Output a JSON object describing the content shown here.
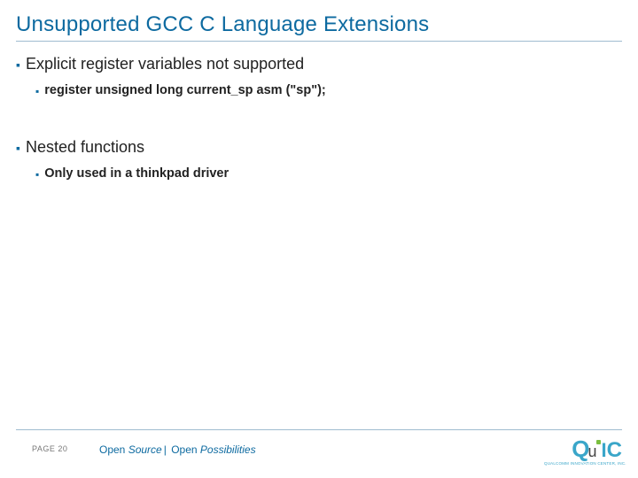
{
  "title": "Unsupported GCC C Language Extensions",
  "bullets": [
    {
      "text": "Explicit register variables not supported",
      "children": [
        {
          "text": "register unsigned long current_sp asm (\"sp\");"
        }
      ]
    },
    {
      "text": "Nested functions",
      "children": [
        {
          "text": "Only used in a thinkpad driver"
        }
      ]
    }
  ],
  "footer": {
    "page_label": "PAGE 20",
    "tagline_a": "Open ",
    "tagline_a_italic": "Source",
    "tagline_divider": "|",
    "tagline_b": " Open ",
    "tagline_b_italic": "Possibilities"
  },
  "logo": {
    "text_q": "Q",
    "text_u": "u",
    "text_i": "I",
    "text_c": "C",
    "subtitle": "QUALCOMM INNOVATION CENTER, INC."
  }
}
